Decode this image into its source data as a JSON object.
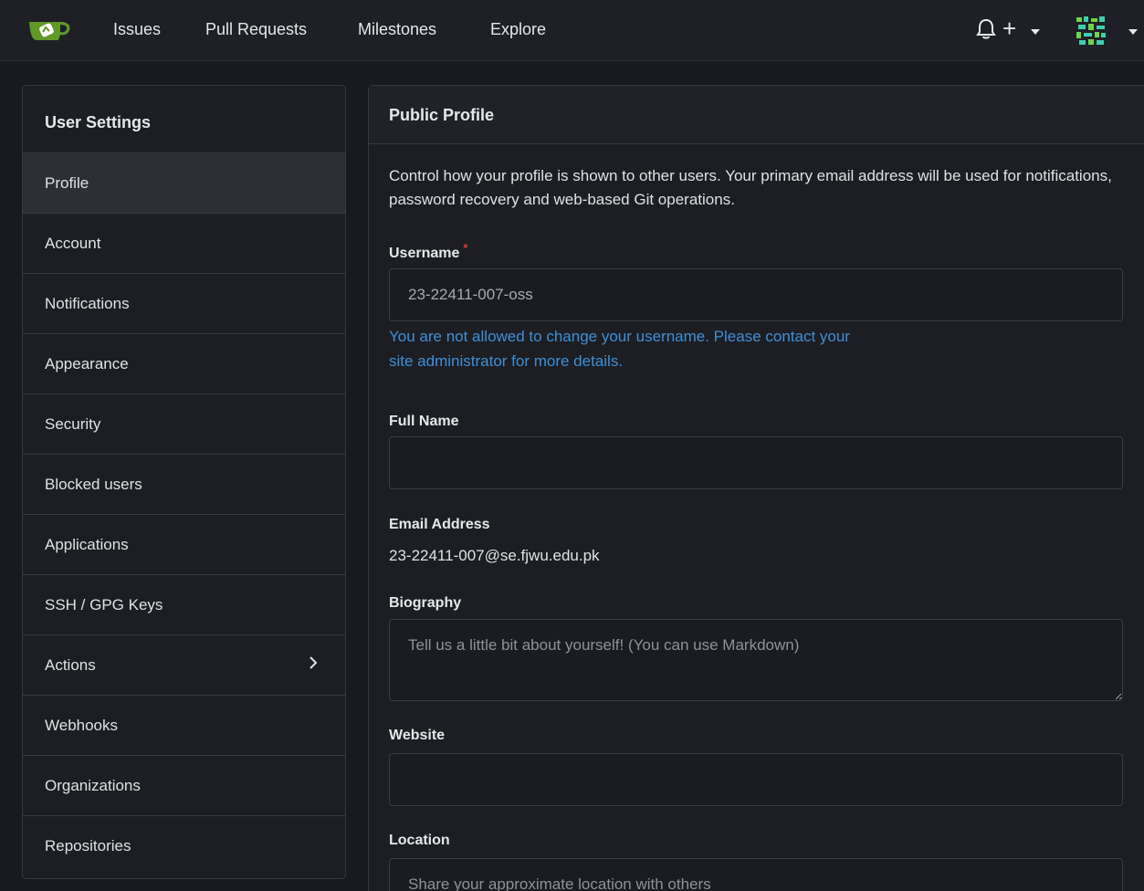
{
  "nav": {
    "links": [
      "Issues",
      "Pull Requests",
      "Milestones",
      "Explore"
    ],
    "plus": "+"
  },
  "sidebar": {
    "title": "User Settings",
    "items": [
      {
        "label": "Profile",
        "active": true
      },
      {
        "label": "Account"
      },
      {
        "label": "Notifications"
      },
      {
        "label": "Appearance"
      },
      {
        "label": "Security"
      },
      {
        "label": "Blocked users"
      },
      {
        "label": "Applications"
      },
      {
        "label": "SSH / GPG Keys"
      },
      {
        "label": "Actions",
        "has_submenu": true
      },
      {
        "label": "Webhooks"
      },
      {
        "label": "Organizations"
      },
      {
        "label": "Repositories"
      }
    ]
  },
  "profile": {
    "title": "Public Profile",
    "description": "Control how your profile is shown to other users. Your primary email address will be used for notifications, password recovery and web-based Git operations.",
    "username_label": "Username",
    "required_mark": "*",
    "username_value": "23-22411-007-oss",
    "username_note": "You are not allowed to change your username. Please contact your site administrator for more details.",
    "fullname_label": "Full Name",
    "fullname_value": "",
    "email_label": "Email Address",
    "email_value": "23-22411-007@se.fjwu.edu.pk",
    "bio_label": "Biography",
    "bio_placeholder": "Tell us a little bit about yourself! (You can use Markdown)",
    "website_label": "Website",
    "website_value": "",
    "location_label": "Location",
    "location_placeholder": "Share your approximate location with others"
  },
  "colors": {
    "accent": "#3f8fd6",
    "required": "#db3a3a",
    "logo": "#609926"
  },
  "icons": [
    "gitea-logo-icon",
    "bell-icon",
    "plus-icon",
    "caret-down-icon",
    "avatar-icon",
    "chevron-right-icon"
  ]
}
